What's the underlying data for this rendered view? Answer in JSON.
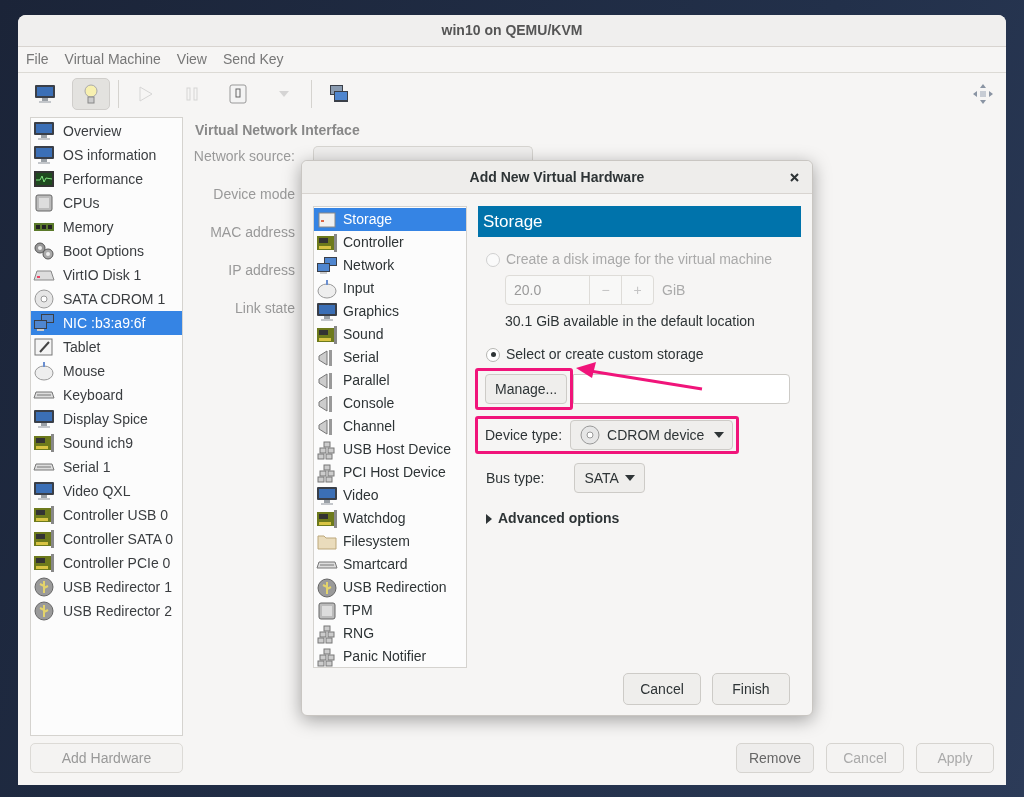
{
  "window": {
    "title": "win10 on QEMU/KVM"
  },
  "menu": [
    "File",
    "Virtual Machine",
    "View",
    "Send Key"
  ],
  "toolbar": [
    {
      "kind": "console",
      "selected": false,
      "disabled": false
    },
    {
      "kind": "details",
      "selected": true,
      "disabled": false
    },
    {
      "kind": "run",
      "selected": false,
      "disabled": true
    },
    {
      "kind": "pause",
      "selected": false,
      "disabled": true
    },
    {
      "kind": "shutdown",
      "selected": false,
      "disabled": false
    },
    {
      "kind": "dropdown",
      "selected": false,
      "disabled": true
    },
    {
      "kind": "snapshots",
      "selected": false,
      "disabled": false
    }
  ],
  "sidebar": {
    "items": [
      {
        "label": "Overview",
        "selected": false
      },
      {
        "label": "OS information",
        "selected": false
      },
      {
        "label": "Performance",
        "selected": false
      },
      {
        "label": "CPUs",
        "selected": false
      },
      {
        "label": "Memory",
        "selected": false
      },
      {
        "label": "Boot Options",
        "selected": false
      },
      {
        "label": "VirtIO Disk 1",
        "selected": false
      },
      {
        "label": "SATA CDROM 1",
        "selected": false
      },
      {
        "label": "NIC :b3:a9:6f",
        "selected": true
      },
      {
        "label": "Tablet",
        "selected": false
      },
      {
        "label": "Mouse",
        "selected": false
      },
      {
        "label": "Keyboard",
        "selected": false
      },
      {
        "label": "Display Spice",
        "selected": false
      },
      {
        "label": "Sound ich9",
        "selected": false
      },
      {
        "label": "Serial 1",
        "selected": false
      },
      {
        "label": "Video QXL",
        "selected": false
      },
      {
        "label": "Controller USB 0",
        "selected": false
      },
      {
        "label": "Controller SATA 0",
        "selected": false
      },
      {
        "label": "Controller PCIe 0",
        "selected": false
      },
      {
        "label": "USB Redirector 1",
        "selected": false
      },
      {
        "label": "USB Redirector 2",
        "selected": false
      }
    ],
    "add_button": {
      "label": "Add Hardware",
      "disabled": true
    }
  },
  "details": {
    "heading": "Virtual Network Interface",
    "labels": [
      "Network source:",
      "Device mode",
      "MAC address",
      "IP address",
      "Link state"
    ]
  },
  "bottom_buttons": [
    {
      "label": "Remove",
      "disabled": false
    },
    {
      "label": "Cancel",
      "disabled": true
    },
    {
      "label": "Apply",
      "disabled": true
    }
  ],
  "dialog": {
    "title": "Add New Virtual Hardware",
    "categories": [
      {
        "label": "Storage",
        "selected": true
      },
      {
        "label": "Controller",
        "selected": false
      },
      {
        "label": "Network",
        "selected": false
      },
      {
        "label": "Input",
        "selected": false
      },
      {
        "label": "Graphics",
        "selected": false
      },
      {
        "label": "Sound",
        "selected": false
      },
      {
        "label": "Serial",
        "selected": false
      },
      {
        "label": "Parallel",
        "selected": false
      },
      {
        "label": "Console",
        "selected": false
      },
      {
        "label": "Channel",
        "selected": false
      },
      {
        "label": "USB Host Device",
        "selected": false
      },
      {
        "label": "PCI Host Device",
        "selected": false
      },
      {
        "label": "Video",
        "selected": false
      },
      {
        "label": "Watchdog",
        "selected": false
      },
      {
        "label": "Filesystem",
        "selected": false
      },
      {
        "label": "Smartcard",
        "selected": false
      },
      {
        "label": "USB Redirection",
        "selected": false
      },
      {
        "label": "TPM",
        "selected": false
      },
      {
        "label": "RNG",
        "selected": false
      },
      {
        "label": "Panic Notifier",
        "selected": false
      }
    ],
    "header": "Storage",
    "create_option": {
      "label": "Create a disk image for the virtual machine",
      "selected": false,
      "disabled": true
    },
    "size": {
      "value": "20.0",
      "disabled": true,
      "minus": "−",
      "plus": "+",
      "unit": "GiB"
    },
    "available": "30.1 GiB available in the default location",
    "custom_option": {
      "label": "Select or create custom storage",
      "selected": true,
      "disabled": false
    },
    "manage_button": "Manage...",
    "device_type": {
      "label": "Device type:",
      "value": "CDROM device"
    },
    "bus_type": {
      "label": "Bus type:",
      "value": "SATA"
    },
    "advanced": {
      "label": "Advanced options",
      "expanded": false
    },
    "buttons": [
      "Cancel",
      "Finish"
    ]
  }
}
